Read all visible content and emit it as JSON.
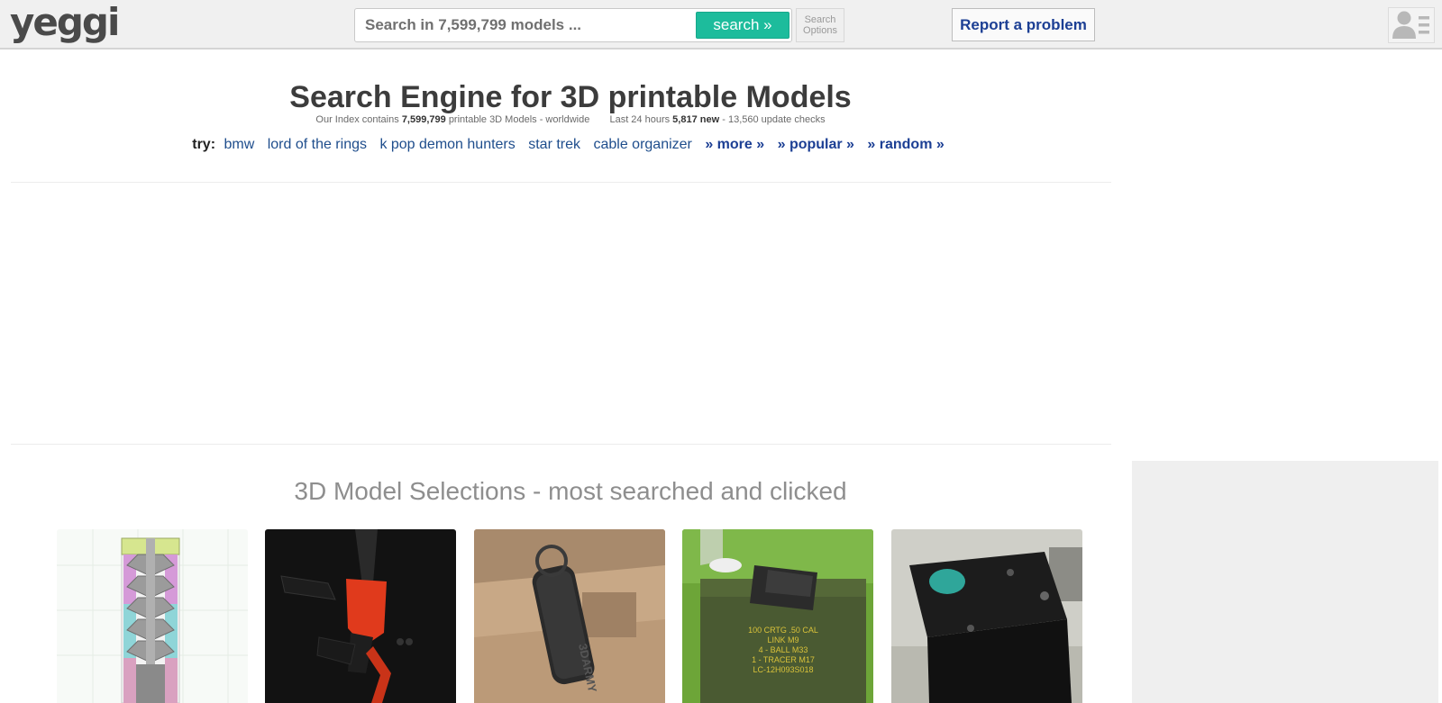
{
  "header": {
    "logo_text": "yeggi",
    "search_placeholder": "Search in 7,599,799 models ...",
    "search_button": "search »",
    "search_options_line1": "Search",
    "search_options_line2": "Options",
    "report_button": "Report a problem",
    "user_icon": "user-profile-icon"
  },
  "hero": {
    "title": "Search Engine for 3D printable Models",
    "sub_prefix": "Our Index contains",
    "model_count": "7,599,799",
    "sub_mid": "printable 3D Models - worldwide",
    "last_24": "Last 24 hours",
    "new_count": "5,817",
    "new_label": "new",
    "update_checks": "- 13,560 update checks"
  },
  "try": {
    "label": "try:",
    "links": [
      "bmw",
      "lord of the rings",
      "k pop demon hunters",
      "star trek",
      "cable organizer"
    ],
    "more": "» more »",
    "popular": "» popular »",
    "random": "» random »"
  },
  "selections": {
    "title": "3D Model Selections - most searched and clicked",
    "cards": [
      {
        "alt": "suppressor-cross-section"
      },
      {
        "alt": "red-rifle-model"
      },
      {
        "alt": "black-grenade-model"
      },
      {
        "alt": "ammo-can-model"
      },
      {
        "alt": "black-box-model"
      }
    ],
    "ammo_can_lines": [
      "100 CRTG .50 CAL",
      "LINK M9",
      "4 - BALL M33",
      "1 - TRACER M17",
      "LC-12H093S018"
    ],
    "grenade_text": "3DARMY"
  },
  "colors": {
    "accent": "#1dbc9c",
    "link": "#1e4d8c",
    "link_bold": "#1c3f94"
  }
}
